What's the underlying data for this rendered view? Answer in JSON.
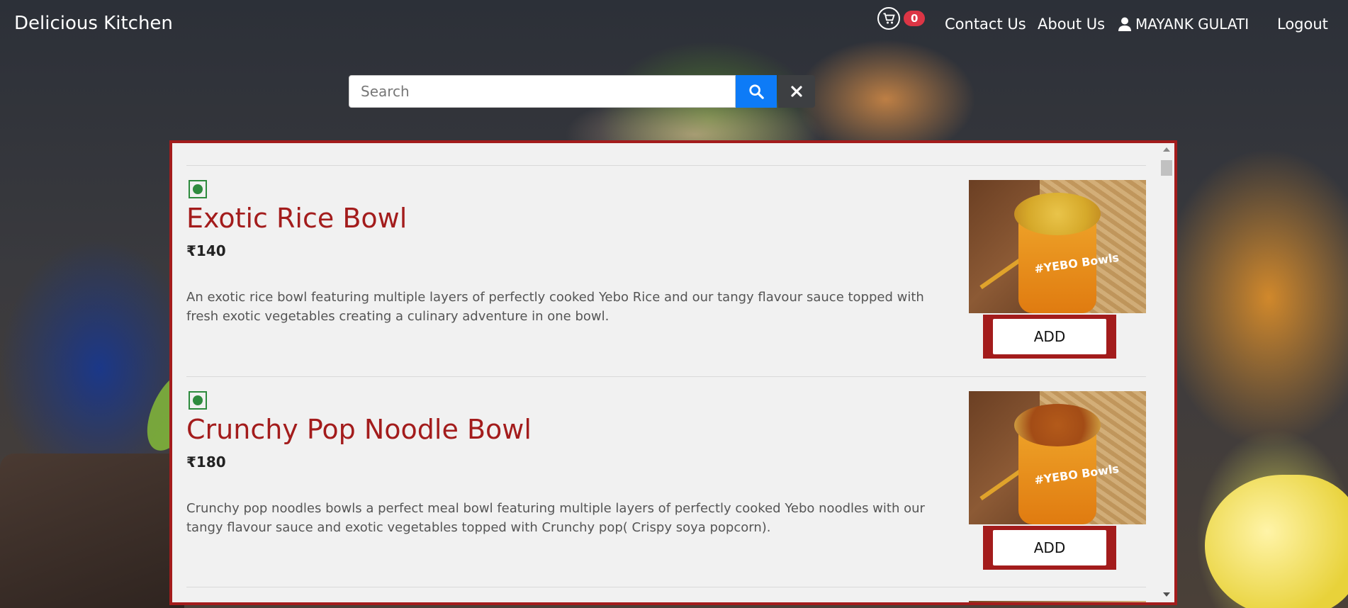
{
  "navbar": {
    "brand": "Delicious Kitchen",
    "cart_count": "0",
    "contact": "Contact Us",
    "about": "About Us",
    "user": "MAYANK GULATI",
    "logout": "Logout"
  },
  "search": {
    "placeholder": "Search",
    "value": ""
  },
  "menu": {
    "items": [
      {
        "name": "Exotic Rice Bowl",
        "price": "₹140",
        "description": "An exotic rice bowl featuring multiple layers of perfectly cooked Yebo Rice and our tangy flavour sauce topped with fresh exotic vegetables creating a culinary adventure in one bowl.",
        "add_label": "ADD",
        "image_caption": "#YEBO Bowls"
      },
      {
        "name": "Crunchy Pop Noodle Bowl",
        "price": "₹180",
        "description": "Crunchy pop noodles bowls a perfect meal bowl featuring multiple layers of perfectly cooked Yebo noodles with our tangy flavour sauce and exotic vegetables topped with Crunchy pop( Crispy soya popcorn).",
        "add_label": "ADD",
        "image_caption": "#YEBO Bowls"
      }
    ]
  },
  "colors": {
    "accent": "#a31c1c",
    "search_button": "#0d7bf7",
    "badge": "#dc3545",
    "veg": "#2e8b3e"
  }
}
